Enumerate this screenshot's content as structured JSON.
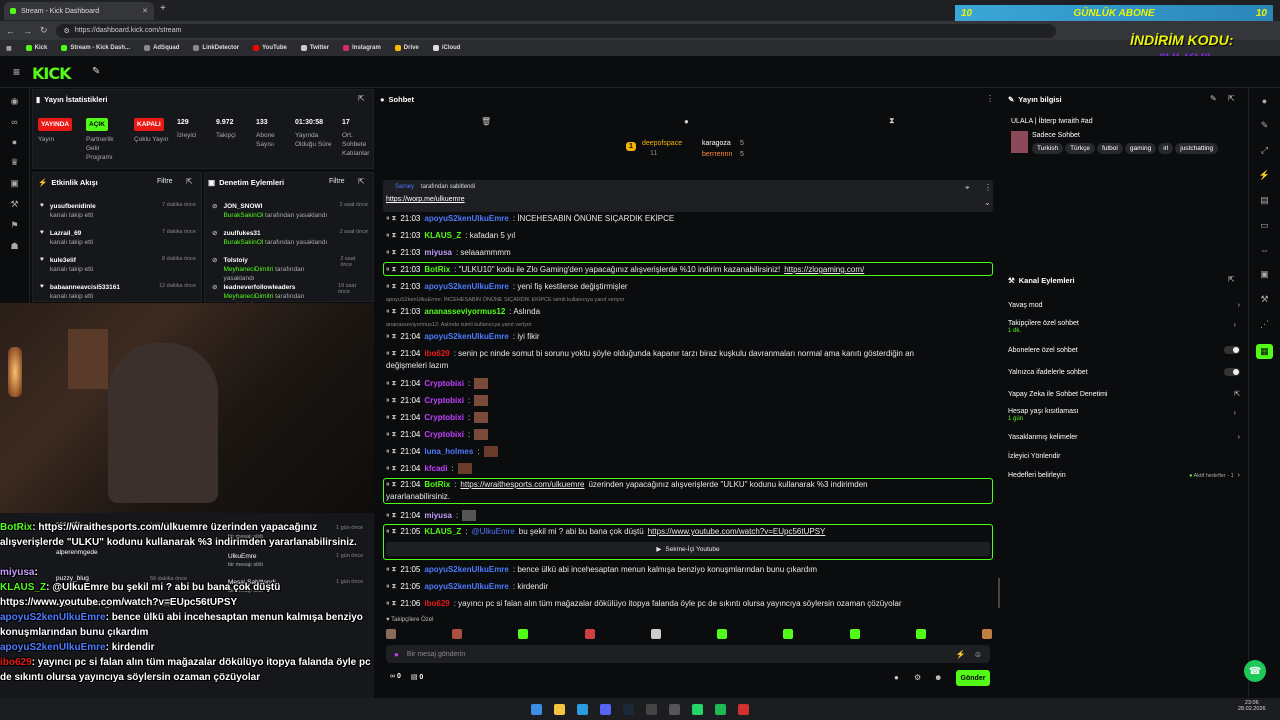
{
  "browser": {
    "tab_title": "Stream - Kick Dashboard",
    "url": "https://dashboard.kick.com/stream",
    "bookmarks": [
      "Kick",
      "Stream - Kick Dash...",
      "AdSquad",
      "LinkDetector",
      "YouTube",
      "Twitter",
      "Instagram",
      "Drive",
      "iCloud"
    ]
  },
  "promo": {
    "top": "GÜNLÜK ABONE",
    "code_label": "İNDİRİM KODU:",
    "code": "\"ULKU\"",
    "left_num": "10",
    "right_num": "10"
  },
  "stats": {
    "title": "Yayın İstatistikleri",
    "items": [
      {
        "value": "YAYINDA",
        "label": "Yayın"
      },
      {
        "value": "AÇIK",
        "label": "Partnerlik Gelir Programı"
      },
      {
        "value": "KAPALI",
        "label": "Çoklu Yayın"
      },
      {
        "value": "129",
        "label": "İzleyici"
      },
      {
        "value": "9.972",
        "label": "Takipçi"
      },
      {
        "value": "133",
        "label": "Abone Sayısı"
      },
      {
        "value": "01:30:58",
        "label": "Yayında Olduğu Süre"
      },
      {
        "value": "17",
        "label": "Ort. Sohbete Katılanlar"
      }
    ]
  },
  "activity": {
    "title": "Etkinlik Akışı",
    "filter": "Filtre",
    "items": [
      {
        "name": "yusufbenidinle",
        "sub": "kanalı takip etti",
        "time": "7 dakika önce"
      },
      {
        "name": "Lazrail_69",
        "sub": "kanalı takip etti",
        "time": "7 dakika önce"
      },
      {
        "name": "kule3elif",
        "sub": "kanalı takip etti",
        "time": "8 dakika önce"
      },
      {
        "name": "babaanneavcisi533161",
        "sub": "kanalı takip etti",
        "time": "12 dakika önce"
      }
    ]
  },
  "moderation": {
    "title": "Denetim Eylemleri",
    "filter": "Filtre",
    "items": [
      {
        "name": "JON_SNOWI",
        "actor": "BurakSakinOl",
        "sub": " tarafından yasaklandı",
        "time": "2 saat önce"
      },
      {
        "name": "zuulfukes31",
        "actor": "BurakSakinOl",
        "sub": " tarafından yasaklandı",
        "time": "2 saat önce"
      },
      {
        "name": "Tolstoiy",
        "actor": "MeyhaneciDimitri",
        "sub": " tarafından yasaklandı",
        "time": "2 saat önce"
      },
      {
        "name": "leadneverfollowleaders",
        "actor": "MeyhaneciDimitri",
        "sub": " tarafından yasaklandı",
        "time": "19 saat önce"
      }
    ]
  },
  "lower_feed": {
    "left": [
      {
        "name": "saatkafa",
        "time": "1 gün önce"
      },
      {
        "name": "alperenmgede",
        "time": ""
      },
      {
        "name": "puzzy_blug",
        "time": "56 dakika önce"
      },
      {
        "name": "natashacarrillo78_580",
        "time": "58 dakika önce"
      }
    ],
    "right": [
      {
        "name": "UlkuEmre",
        "sub": "bir mesajı sildi",
        "time": "1 gün önce"
      },
      {
        "name": "UlkuEmre",
        "sub": "bir mesajı sildi",
        "time": "1 gün önce"
      },
      {
        "name": "Mesaj Sabitlendi",
        "sub": "bir mesajı sildi",
        "time": "1 gün önce"
      }
    ]
  },
  "overlay_chat": [
    {
      "user": "BotRix",
      "text": ": https://wraithesports.com/ulkuemre üzerinden yapacağınız alışverişlerde \"ULKU\" kodunu kullanarak %3 indirimden yararlanabilirsiniz."
    },
    {
      "user": "miyusa",
      "text": ":"
    },
    {
      "user": "KLAUS_Z",
      "text": ": @UlkuEmre bu şekil mi ? abi bu bana çok düştü https://www.youtube.com/watch?v=EUpc56tUPSY"
    },
    {
      "user": "apoyuS2kenUlkuEmre",
      "text": ": bence ülkü abi incehesaptan menun kalmışa benziyo konuşmlarından bunu çıkardım"
    },
    {
      "user": "apoyuS2kenUlkuEmre",
      "text": ": kirdendir"
    },
    {
      "user": "ibo629",
      "text": ": yayıncı pc si falan alın tüm mağazalar dökülüyo itopya falanda öyle pc de sıkıntı olursa yayıncıya söylersin ozaman çözüyolar"
    }
  ],
  "chat": {
    "title": "Sohbet",
    "top_users": [
      {
        "rank": "1",
        "name": "deepofspace",
        "count": "11"
      },
      {
        "name": "karagoza",
        "count": "5"
      },
      {
        "name": "berrrennn",
        "count": "5"
      }
    ],
    "pinned": {
      "by": "Sarney",
      "label": "tarafından sabitlendi",
      "link": "https://worp.me/ulkuemre"
    },
    "messages": [
      {
        "time": "21:03",
        "user": "apoyuS2kenUlkuEmre",
        "text": ": İNCEHESABIN ÖNÜNE SIÇARDIK EKİPCE"
      },
      {
        "time": "21:03",
        "user": "KLAUS_Z",
        "text": ": kafadan 5 yıl"
      },
      {
        "time": "21:03",
        "user": "miyusa",
        "text": ": selaaammmm"
      },
      {
        "time": "21:03",
        "user": "BotRix",
        "text": ": \"ULKU10\" kodu ile Zlo Gaming'den yapacağınız alışverişlerde %10 indirim kazanabilirsiniz! ",
        "link": "https://zlogaming.com/"
      },
      {
        "time": "21:03",
        "user": "apoyuS2kenUlkuEmre",
        "text": ": yeni fiş kestilerse değiştirmişler"
      },
      {
        "reply": "apoyuS2kenUlkuEmre: İNCEHESABIN ÖNÜNE SIÇARDIK EKİPCE isimli kullanıcıya yanıt veriyor"
      },
      {
        "time": "21:03",
        "user": "ananasseviyormus12",
        "text": ": Aslında"
      },
      {
        "reply": "ananasseviyormus12: Aslında isimli kullanıcıya yanıt veriyor"
      },
      {
        "time": "21:04",
        "user": "apoyuS2kenUlkuEmre",
        "text": ": iyi fikir"
      },
      {
        "time": "21:04",
        "user": "ibo629",
        "text": ": senin pc ninde somut bi sorunu yoktu şöyle olduğunda kapanır tarzı biraz kuşkulu davranmaları normal ama kanıtı gösterdiğin an"
      },
      {
        "cont": "değişmeleri lazım"
      },
      {
        "time": "21:04",
        "user": "Cryptobixi",
        "text": ":"
      },
      {
        "time": "21:04",
        "user": "Cryptobixi",
        "text": ":"
      },
      {
        "time": "21:04",
        "user": "Cryptobixi",
        "text": ":"
      },
      {
        "time": "21:04",
        "user": "Cryptobixi",
        "text": ":"
      },
      {
        "time": "21:04",
        "user": "luna_holmes",
        "text": ":"
      },
      {
        "time": "21:04",
        "user": "kfcadi",
        "text": ":"
      },
      {
        "time": "21:04",
        "user": "BotRix",
        "text": ": ",
        "link": "https://wraithesports.com/ulkuemre",
        "after": " üzerinden yapacağınız alışverişlerde \"ULKU\" kodunu kullanarak %3 indirimden"
      },
      {
        "cont": "yararlanabilirsiniz."
      },
      {
        "time": "21:04",
        "user": "miyusa",
        "text": ":"
      },
      {
        "time": "21:05",
        "user": "KLAUS_Z",
        "text": ": ",
        "mention": "@UlkuEmre",
        "after": " bu şekil mi ? abi bu bana çok düştü ",
        "link": "https://www.youtube.com/watch?v=EUpc56tUPSY"
      },
      {
        "embed": "Sekme-İçi Youtube"
      },
      {
        "time": "21:05",
        "user": "apoyuS2kenUlkuEmre",
        "text": ": bence ülkü abi incehesaptan menun kalmışa benziyo konuşmlarından bunu çıkardım"
      },
      {
        "time": "21:05",
        "user": "apoyuS2kenUlkuEmre",
        "text": ": kirdendir"
      },
      {
        "time": "21:06",
        "user": "ibo629",
        "text": ": yayıncı pc si falan alın tüm mağazalar dökülüyo itopya falanda öyle pc de sıkıntı olursa yayıncıya söylersin ozaman çözüyolar"
      }
    ],
    "followers_only": "Takipçilere Özel",
    "input_placeholder": "Bir mesaj gönderin",
    "send": "Gönder",
    "counts": [
      "0",
      "0"
    ]
  },
  "stream_info": {
    "title": "Yayın bilgisi",
    "stream_title": "ULALA | İbterp twraith #ad",
    "category": "Sadece Sohbet",
    "tags": [
      "Turkish",
      "Türkçe",
      "futbol",
      "gaming",
      "irl",
      "justchatting"
    ]
  },
  "channel_actions": {
    "title": "Kanal Eylemleri",
    "items": [
      {
        "label": "Yavaş mod"
      },
      {
        "label": "Takipçilere özel sohbet",
        "sub": "1 dk."
      },
      {
        "label": "Abonelere özel sohbet"
      },
      {
        "label": "Yalnızca ifadelerle sohbet"
      },
      {
        "label": "Yapay Zeka ile Sohbet Denetimi"
      },
      {
        "label": "Hesap yaşı kısıtlaması",
        "sub": "1 gün"
      },
      {
        "label": "Yasaklanmış kelimeler"
      },
      {
        "label": "İzleyici Yönlendir"
      },
      {
        "label": "Hedefleri belirleyin",
        "extra": "Aktif hedefler - 1"
      }
    ]
  },
  "colors": {
    "accent": "#53fc18",
    "live": "#e91916",
    "bg": "#0b0c0e",
    "panel": "#15171a"
  },
  "taskbar": {
    "time": "23:06",
    "date": "28.02.2026"
  }
}
